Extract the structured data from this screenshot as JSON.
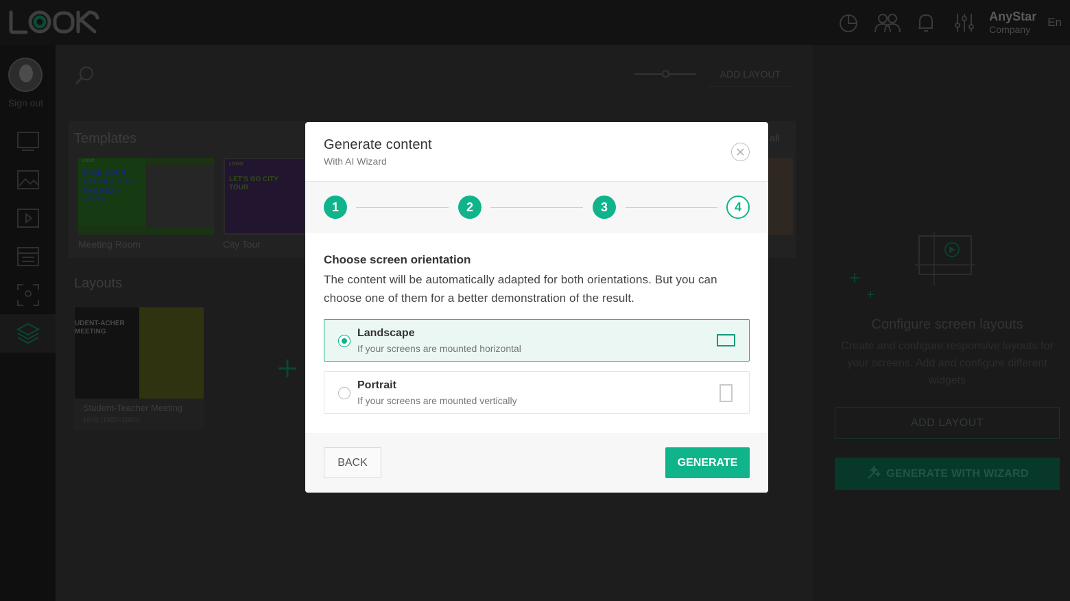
{
  "colors": {
    "accent": "#0fb48a",
    "overlay_dark": "#111111"
  },
  "header": {
    "logo_text": "LOOK",
    "icons": [
      "analytics-icon",
      "users-icon",
      "bell-icon",
      "sliders-icon"
    ],
    "user_name": "AnyStar",
    "user_company": "Company",
    "language": "En"
  },
  "sidebar": {
    "sign_out_label": "Sign out",
    "items": [
      "screens-icon",
      "images-icon",
      "media-icon",
      "schedule-icon",
      "scan-icon",
      "layers-icon"
    ],
    "active_item": "layers-icon"
  },
  "main": {
    "add_layout_label": "ADD LAYOUT",
    "templates_title": "Templates",
    "see_all_label": "all",
    "templates": [
      {
        "name": "Meeting Room",
        "headline": "TAKE YOUR MEETINGS TO THE NEXT LEVEL",
        "logo": "LOGO"
      },
      {
        "name": "City Tour",
        "headline": "LET'S GO CITY TOUR",
        "logo": "LOGO"
      }
    ],
    "layouts_title": "Layouts",
    "layouts": [
      {
        "name": "Student-Teacher Meeting",
        "meta": "16×9 (1920×1080)",
        "headline": "UDENT-ACHER MEETING"
      }
    ]
  },
  "right_panel": {
    "title": "Configure screen layouts",
    "description": "Create and configure responsive layouts for your screens. Add and configure different widgets",
    "add_layout_label": "ADD LAYOUT",
    "wizard_label": "GENERATE WITH WIZARD"
  },
  "modal": {
    "title": "Generate content",
    "subtitle": "With AI Wizard",
    "steps": [
      {
        "number": "1",
        "state": "done"
      },
      {
        "number": "2",
        "state": "done"
      },
      {
        "number": "3",
        "state": "done"
      },
      {
        "number": "4",
        "state": "current"
      }
    ],
    "section_title": "Choose screen orientation",
    "section_description": "The content will be automatically adapted for both orientations. But you can choose one of them for a better demonstration of the result.",
    "options": [
      {
        "label": "Landscape",
        "description": "If your screens are mounted horizontal",
        "selected": true,
        "icon": "landscape-icon"
      },
      {
        "label": "Portrait",
        "description": "If your screens are mounted vertically",
        "selected": false,
        "icon": "portrait-icon"
      }
    ],
    "back_label": "BACK",
    "generate_label": "GENERATE"
  }
}
